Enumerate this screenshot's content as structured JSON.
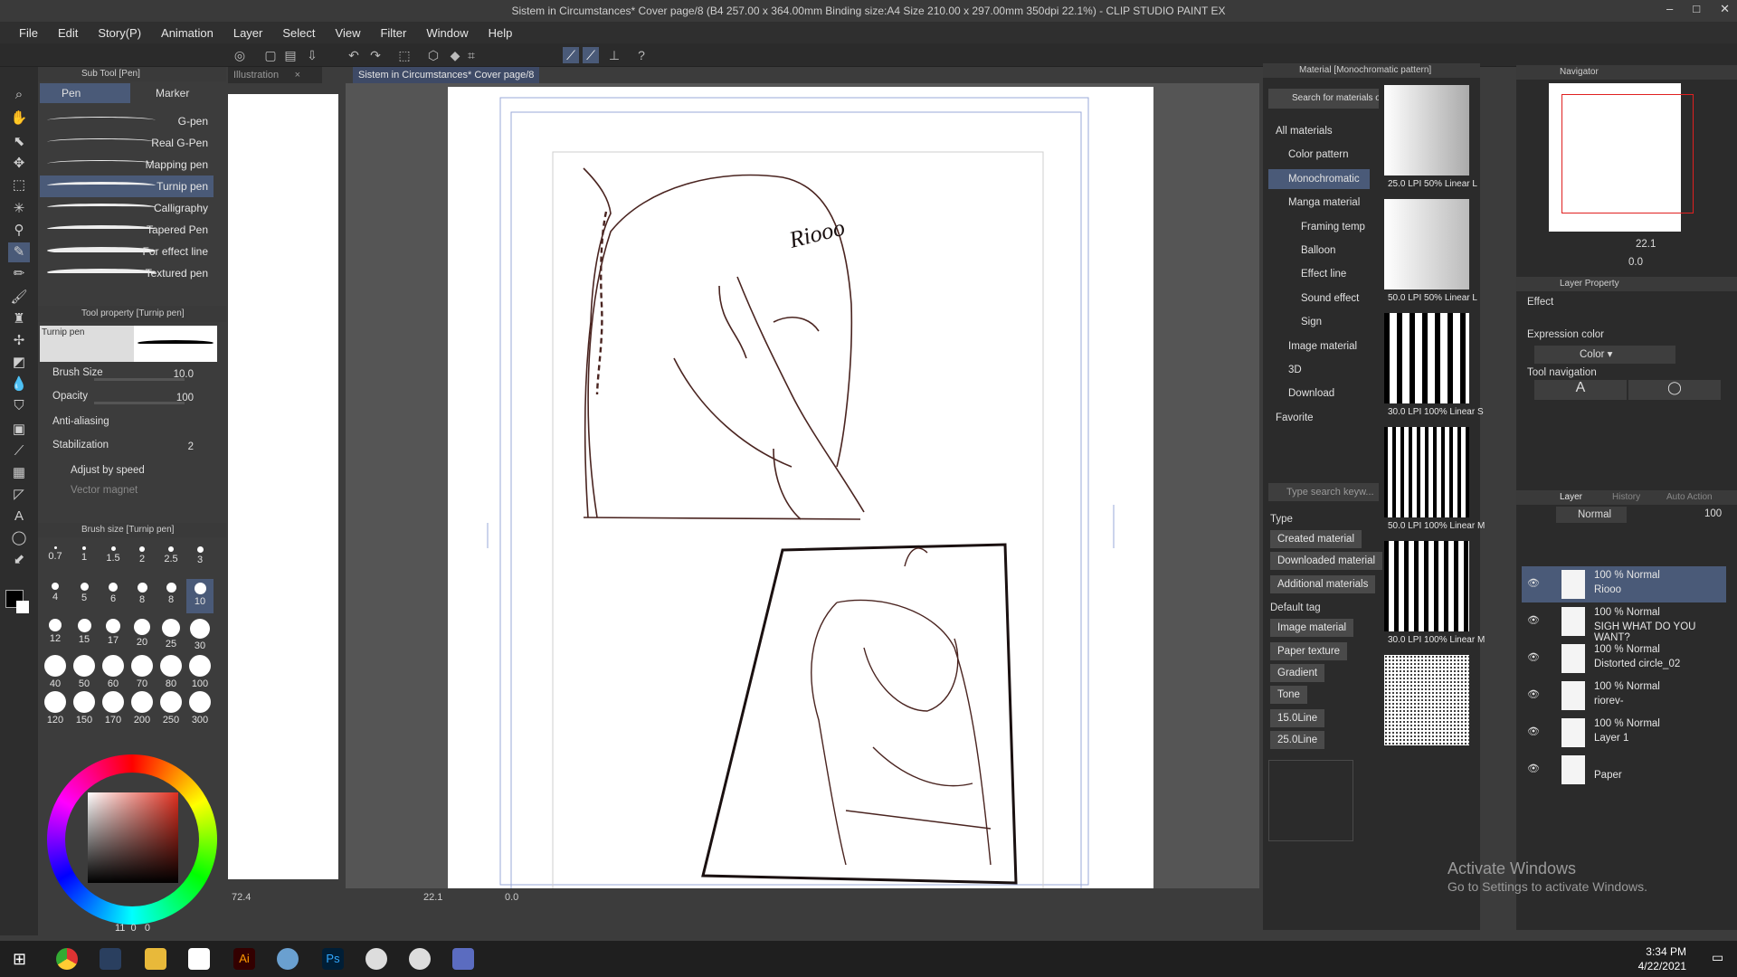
{
  "window": {
    "title": "Sistem in Circumstances* Cover page/8 (B4 257.00 x 364.00mm Binding size:A4 Size 210.00 x 297.00mm 350dpi 22.1%) - CLIP STUDIO PAINT EX",
    "controls": [
      "–",
      "□",
      "✕"
    ]
  },
  "menu": [
    "File",
    "Edit",
    "Story(P)",
    "Animation",
    "Layer",
    "Select",
    "View",
    "Filter",
    "Window",
    "Help"
  ],
  "subtool": {
    "header": "Sub Tool [Pen]",
    "tabs": [
      "Pen",
      "Marker"
    ],
    "items": [
      "G-pen",
      "Real G-Pen",
      "Mapping pen",
      "Turnip pen",
      "Calligraphy",
      "Tapered Pen",
      "For effect line",
      "Textured pen"
    ],
    "selected": "Turnip pen"
  },
  "toolprop": {
    "header": "Tool property [Turnip pen]",
    "preview_label": "Turnip pen",
    "brush_size_label": "Brush Size",
    "brush_size_value": "10.0",
    "opacity_label": "Opacity",
    "opacity_value": "100",
    "antialias_label": "Anti-aliasing",
    "stabilization_label": "Stabilization",
    "stabilization_value": "2",
    "adjust_label": "Adjust by speed",
    "vector_label": "Vector magnet"
  },
  "brushsize": {
    "header": "Brush size [Turnip pen]",
    "sizes": [
      "0.7",
      "1",
      "1.5",
      "2",
      "2.5",
      "3",
      "4",
      "5",
      "6",
      "8",
      "8",
      "10",
      "12",
      "15",
      "17",
      "20",
      "25",
      "30",
      "40",
      "50",
      "60",
      "70",
      "80",
      "100",
      "120",
      "150",
      "170",
      "200",
      "250",
      "300"
    ],
    "selected": "10"
  },
  "color": {
    "main": "#000000",
    "sub": "#ffffff",
    "readout": [
      "11",
      "0",
      "0"
    ]
  },
  "tabs": {
    "illustration": "Illustration",
    "document": "Sistem in Circumstances* Cover page/8"
  },
  "canvas": {
    "signature": "Riooo"
  },
  "status": {
    "left_zoom": "72.4",
    "zoom": "22.1",
    "rotation": "0.0"
  },
  "material": {
    "header": "Material [Monochromatic pattern]",
    "search_top": "Search for materials on ASSETS",
    "tree": [
      "All materials",
      "Color pattern",
      "Monochromatic",
      "Manga material",
      "Framing temp",
      "Balloon",
      "Effect line",
      "Sound effect",
      "Sign",
      "Image material",
      "3D",
      "Download",
      "Favorite"
    ],
    "selected": "Monochromatic",
    "search_placeholder": "Type search keyw...",
    "type_label": "Type",
    "type_buttons": [
      "Created material",
      "Downloaded material",
      "Additional materials"
    ],
    "tag_label": "Default tag",
    "tag_buttons": [
      "Image material",
      "Paper texture",
      "Gradient",
      "Tone",
      "15.0Line",
      "25.0Line"
    ],
    "thumbs": [
      "25.0 LPI 50% Linear L",
      "50.0 LPI 50% Linear L",
      "30.0 LPI 100% Linear S",
      "50.0 LPI 100% Linear M",
      "30.0 LPI 100% Linear M",
      ""
    ]
  },
  "navigator": {
    "header": "Navigator",
    "zoom": "22.1",
    "rotation": "0.0"
  },
  "layerprop": {
    "header": "Layer Property",
    "effect_label": "Effect",
    "expr_label": "Expression color",
    "expr_value": "Color",
    "toolnav_label": "Tool navigation"
  },
  "layers": {
    "tabs": [
      "Layer",
      "History",
      "Auto Action"
    ],
    "blend": "Normal",
    "opacity": "100",
    "items": [
      {
        "mode": "100 % Normal",
        "name": "Riooo"
      },
      {
        "mode": "100 % Normal",
        "name": "SIGH WHAT DO YOU WANT?"
      },
      {
        "mode": "100 % Normal",
        "name": "Distorted circle_02"
      },
      {
        "mode": "100 % Normal",
        "name": "riorev-"
      },
      {
        "mode": "100 % Normal",
        "name": "Layer 1"
      },
      {
        "mode": "",
        "name": "Paper"
      }
    ]
  },
  "activation": {
    "line1": "Activate Windows",
    "line2": "Go to Settings to activate Windows."
  },
  "taskbar": {
    "time": "3:34 PM",
    "date": "4/22/2021"
  }
}
